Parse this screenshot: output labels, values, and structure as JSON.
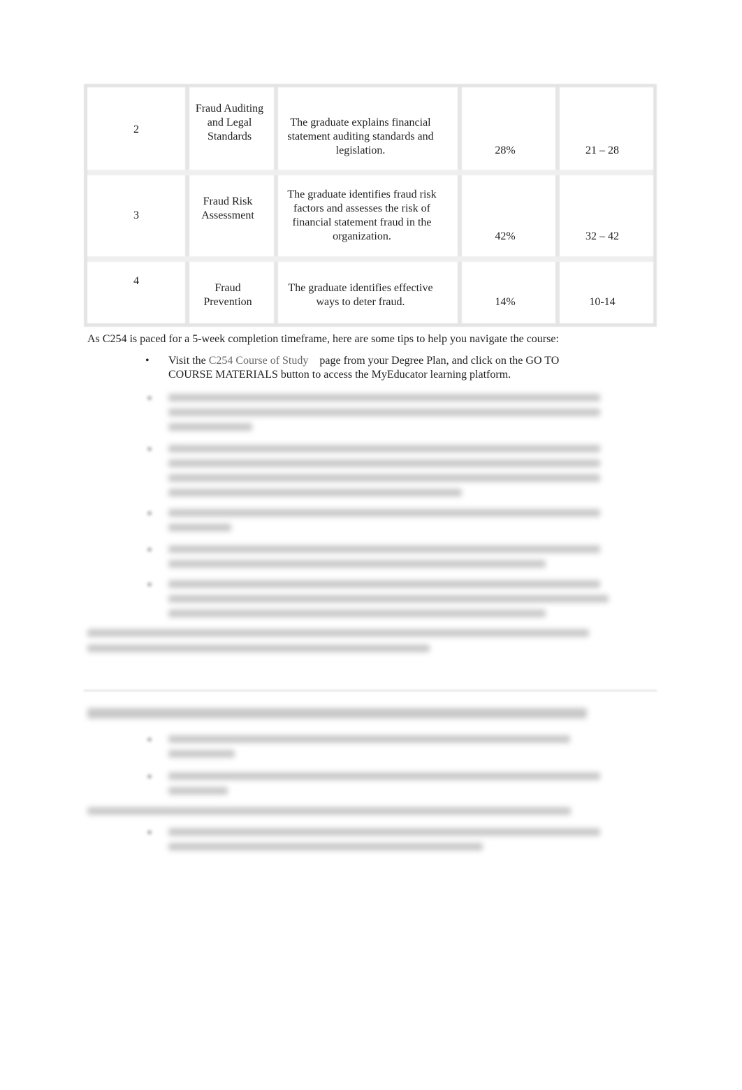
{
  "table": {
    "rows": [
      {
        "number": "2",
        "topic": "Fraud Auditing and Legal Standards",
        "competency": "The graduate explains financial statement auditing standards and legislation.",
        "weight": "28%",
        "items": "21 – 28"
      },
      {
        "number": "3",
        "topic": "Fraud Risk Assessment",
        "competency": "The graduate identifies fraud risk factors and assesses the risk of financial statement fraud in the organization.",
        "weight": "42%",
        "items": "32 – 42"
      },
      {
        "number": "4",
        "topic": "Fraud Prevention",
        "competency": "The graduate identifies effective ways to deter fraud.",
        "weight": "14%",
        "items": "10-14"
      }
    ]
  },
  "intro": "As C254 is paced for a 5-week completion timeframe, here are some tips to help you navigate the course:",
  "tips": {
    "bullet": "•",
    "first_prefix": "Visit the",
    "first_link": "C254 Course of Study",
    "first_suffix": "page from your Degree Plan, and click on the GO TO",
    "first_line2": "COURSE MATERIALS button to access the MyEducator learning platform."
  }
}
